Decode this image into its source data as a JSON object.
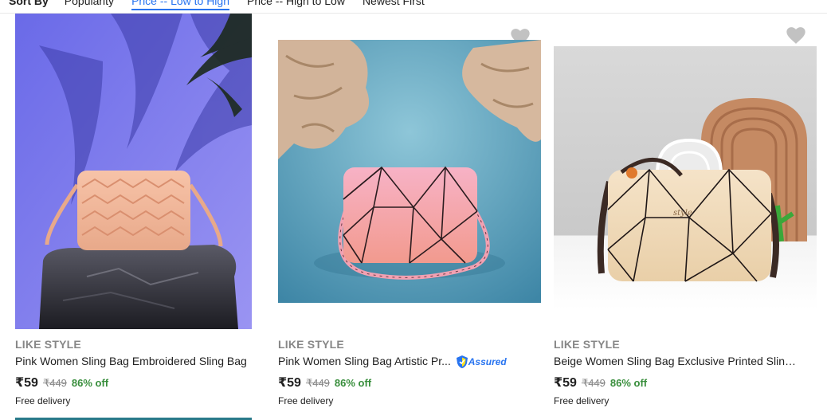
{
  "sort": {
    "label": "Sort By",
    "options": [
      "Popularity",
      "Price -- Low to High",
      "Price -- High to Low",
      "Newest First"
    ],
    "active_index": 1
  },
  "products": [
    {
      "brand": "LIKE STYLE",
      "title": "Pink Women Sling Bag Embroidered Sling Bag",
      "price": "₹59",
      "mrp": "₹449",
      "discount": "86% off",
      "delivery": "Free delivery",
      "assured": false,
      "wishlist_icon": "heart-icon",
      "image_desc": "peach-quilted-sling-bag"
    },
    {
      "brand": "LIKE STYLE",
      "title": "Pink Women Sling Bag Artistic Pr...",
      "price": "₹59",
      "mrp": "₹449",
      "discount": "86% off",
      "delivery": "Free delivery",
      "assured": true,
      "assured_label": "Assured",
      "wishlist_icon": "heart-icon",
      "image_desc": "pink-geometric-sling-bag"
    },
    {
      "brand": "LIKE STYLE",
      "title": "Beige Women Sling Bag Exclusive Printed Sling Bag",
      "price": "₹59",
      "mrp": "₹449",
      "discount": "86% off",
      "delivery": "Free delivery",
      "assured": false,
      "wishlist_icon": "heart-icon",
      "image_desc": "beige-geometric-sling-bag"
    }
  ],
  "colors": {
    "accent": "#2874f0",
    "discount": "#388e3c",
    "muted": "#878787"
  }
}
